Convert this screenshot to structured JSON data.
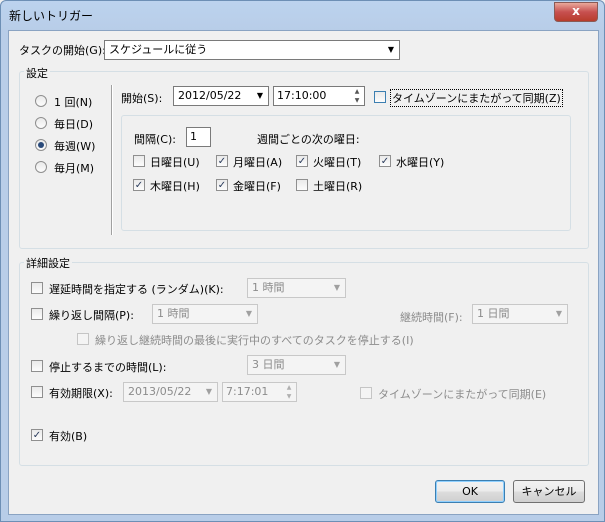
{
  "window": {
    "title": "新しいトリガー",
    "close_glyph": "x"
  },
  "start_task": {
    "label": "タスクの開始(G):",
    "value": "スケジュールに従う"
  },
  "settings": {
    "group_label": "設定",
    "radios": [
      {
        "label": "1 回(N)",
        "selected": false
      },
      {
        "label": "毎日(D)",
        "selected": false
      },
      {
        "label": "毎週(W)",
        "selected": true
      },
      {
        "label": "毎月(M)",
        "selected": false
      }
    ],
    "start_label": "開始(S):",
    "start_date": "2012/05/22",
    "start_time": "17:10:00",
    "sync_tz_label": "タイムゾーンにまたがって同期(Z)",
    "sync_tz_checked": false,
    "interval_label": "間隔(C):",
    "interval_value": "1",
    "weekday_heading": "週間ごとの次の曜日:",
    "days": [
      {
        "label": "日曜日(U)",
        "checked": false
      },
      {
        "label": "月曜日(A)",
        "checked": true
      },
      {
        "label": "火曜日(T)",
        "checked": true
      },
      {
        "label": "水曜日(Y)",
        "checked": true
      },
      {
        "label": "木曜日(H)",
        "checked": true
      },
      {
        "label": "金曜日(F)",
        "checked": true
      },
      {
        "label": "土曜日(R)",
        "checked": false
      }
    ]
  },
  "advanced": {
    "group_label": "詳細設定",
    "delay_label": "遅延時間を指定する (ランダム)(K):",
    "delay_value": "1 時間",
    "repeat_label": "繰り返し間隔(P):",
    "repeat_value": "1 時間",
    "duration_label": "継続時間(F):",
    "duration_value": "1 日間",
    "stop_running_label": "繰り返し継続時間の最後に実行中のすべてのタスクを停止する(I)",
    "stop_after_label": "停止するまでの時間(L):",
    "stop_after_value": "3 日間",
    "expire_label": "有効期限(X):",
    "expire_date": "2013/05/22",
    "expire_time": "7:17:01",
    "expire_sync_label": "タイムゾーンにまたがって同期(E)",
    "enabled_label": "有効(B)",
    "enabled_checked": true
  },
  "buttons": {
    "ok": "OK",
    "cancel": "キャンセル"
  },
  "glyphs": {
    "check": "✓",
    "dropdown": "▼",
    "up": "▲",
    "down": "▼"
  }
}
